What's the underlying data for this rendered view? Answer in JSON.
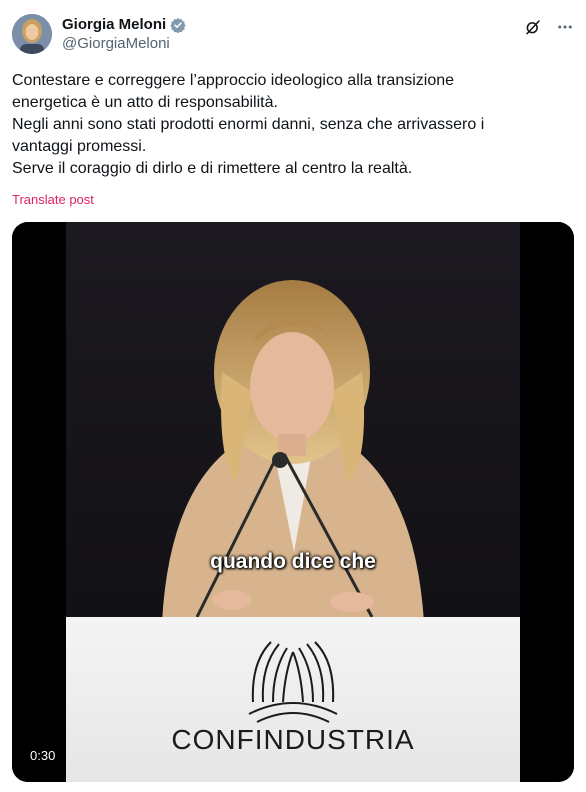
{
  "author": {
    "name": "Giorgia Meloni",
    "handle": "@GiorgiaMeloni"
  },
  "tweet": {
    "lines": [
      "Contestare e correggere l’approccio ideologico alla transizione",
      "energetica è un atto di responsabilità.",
      "Negli anni sono stati prodotti enormi danni, senza che arrivassero i",
      "vantaggi promessi.",
      "Serve il coraggio di dirlo e di rimettere al centro la realtà."
    ],
    "translate_label": "Translate post"
  },
  "video": {
    "caption": "quando dice che",
    "podium_brand": "CONFINDUSTRIA",
    "timestamp": "0:30"
  },
  "icons": {
    "verified": "verified-badge-icon",
    "grok": "grok-icon",
    "more": "more-icon"
  },
  "colors": {
    "verified": "#829aab",
    "translate": "#e0245e",
    "text": "#0f1419",
    "muted": "#536471"
  }
}
